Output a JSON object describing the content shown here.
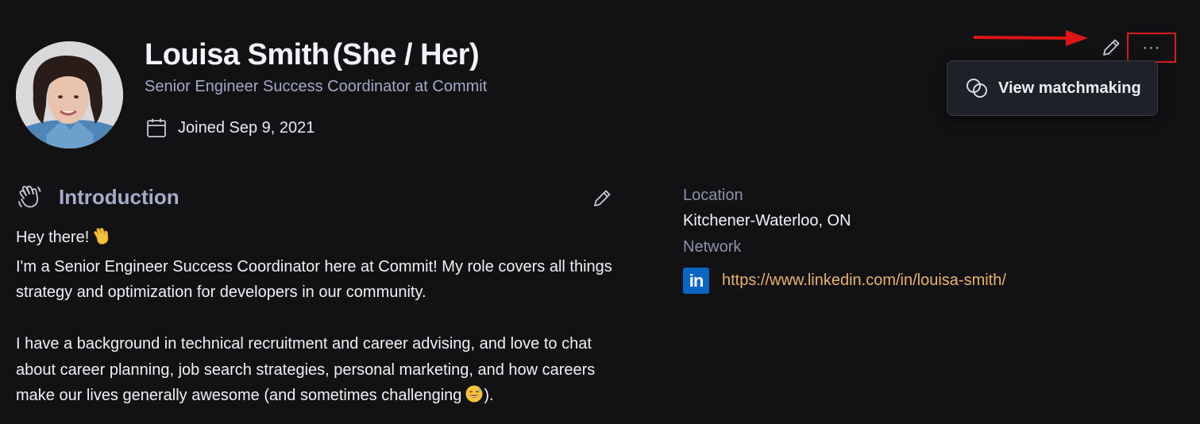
{
  "profile": {
    "name": "Louisa Smith",
    "pronouns": "(She / Her)",
    "title": "Senior Engineer Success Coordinator at Commit",
    "joined": "Joined Sep 9, 2021",
    "avatar_icon": "profile-photo"
  },
  "actions": {
    "more_label": "···",
    "menu": {
      "view_matchmaking": "View matchmaking"
    },
    "annotation_color": "#d61f1f"
  },
  "introduction": {
    "heading": "Introduction",
    "greeting": "Hey there!",
    "line1": "I'm a Senior Engineer Success Coordinator here at Commit! My role covers all things strategy and optimization for developers in our community.",
    "line2": "I have a background in technical recruitment and career advising, and love to chat about career planning, job search strategies, personal marketing, and how careers make our lives generally awesome (and sometimes challenging",
    "line2_end": ")."
  },
  "details": {
    "location_label": "Location",
    "location_value": "Kitchener-Waterloo, ON",
    "network_label": "Network",
    "linkedin_url": "https://www.linkedin.com/in/louisa-smith/",
    "linkedin_icon_text": "in",
    "link_color": "#e8b36a"
  }
}
